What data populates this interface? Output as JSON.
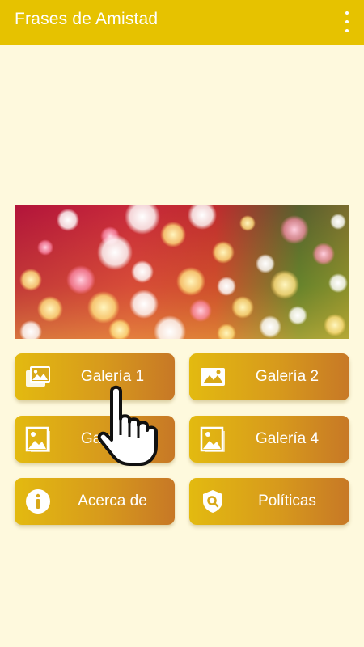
{
  "appbar": {
    "title": "Frases de Amistad",
    "menu_icon": "more-vert-icon"
  },
  "banner": {
    "description_icon": "bokeh-image"
  },
  "buttons": [
    {
      "label": "Galería 1",
      "icon": "photo-icon"
    },
    {
      "label": "Galería 2",
      "icon": "image-icon"
    },
    {
      "label": "Galería 3",
      "icon": "photo-library-icon"
    },
    {
      "label": "Galería 4",
      "icon": "photo-library-icon"
    },
    {
      "label": "Acerca de",
      "icon": "info-icon"
    },
    {
      "label": "Políticas",
      "icon": "shield-search-icon"
    }
  ],
  "colors": {
    "appbar": "#E6C200",
    "background": "#FEF9DD",
    "button_start": "#E3BA10",
    "button_end": "#C77826"
  }
}
